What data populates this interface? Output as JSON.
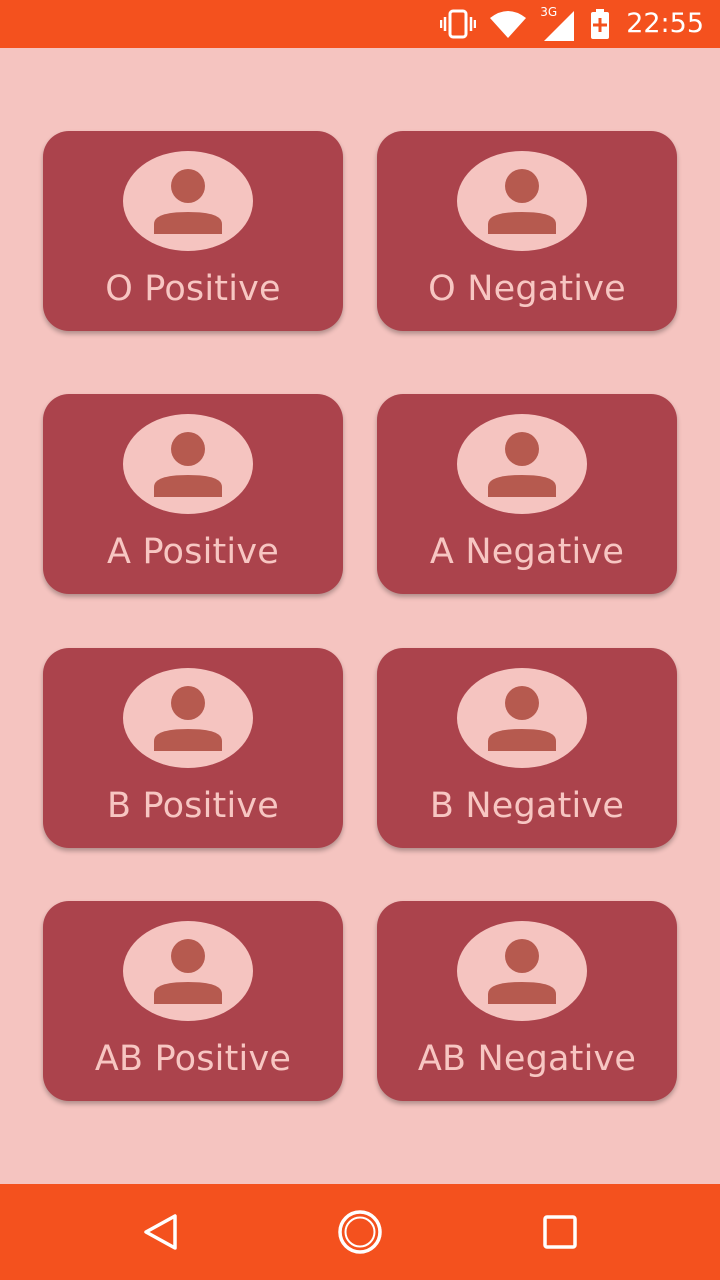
{
  "status_bar": {
    "time": "22:55",
    "network": "3G",
    "icons": [
      "vibrate-icon",
      "wifi-icon",
      "cell-signal-icon",
      "battery-charging-icon"
    ],
    "color": "#f4511e"
  },
  "blood_groups": [
    {
      "label": "O Positive"
    },
    {
      "label": "O Negative"
    },
    {
      "label": "A Positive"
    },
    {
      "label": "A Negative"
    },
    {
      "label": "B Positive"
    },
    {
      "label": "B Negative"
    },
    {
      "label": "AB Positive"
    },
    {
      "label": "AB Negative"
    }
  ],
  "theme": {
    "background": "#f5c4c0",
    "card": "#ab434c",
    "avatar_bg": "#f5c4c0",
    "avatar_figure": "#b65a4f",
    "label_text": "#f7c6c2"
  },
  "nav_bar": {
    "buttons": [
      "back-icon",
      "home-icon",
      "recents-icon"
    ]
  }
}
